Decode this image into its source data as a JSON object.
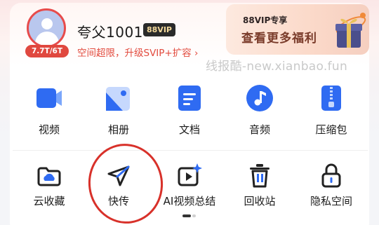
{
  "user": {
    "name": "夸父1001",
    "vip_badge": "88VIP",
    "quota": "7.7T/6T",
    "upgrade_text": "空间超限，升级SVIP+扩容 ›"
  },
  "promo": {
    "top_text": "88VIP专享",
    "main_text": "查看更多福利"
  },
  "watermark": "线报酷-new.xianbao.fun",
  "row1": [
    {
      "label": "视频",
      "icon": "video-icon"
    },
    {
      "label": "相册",
      "icon": "photo-album-icon"
    },
    {
      "label": "文档",
      "icon": "document-icon"
    },
    {
      "label": "音频",
      "icon": "music-note-icon"
    },
    {
      "label": "压缩包",
      "icon": "zip-archive-icon"
    }
  ],
  "row2": [
    {
      "label": "云收藏",
      "icon": "cloud-collection-icon"
    },
    {
      "label": "快传",
      "icon": "paper-plane-icon"
    },
    {
      "label": "AI视频总结",
      "icon": "ai-video-summary-icon"
    },
    {
      "label": "回收站",
      "icon": "trash-icon"
    },
    {
      "label": "隐私空间",
      "icon": "lock-icon"
    }
  ],
  "colors": {
    "accent_red": "#e24a3d",
    "icon_blue": "#2f6bf2",
    "circle_annotation": "#d8312a"
  }
}
